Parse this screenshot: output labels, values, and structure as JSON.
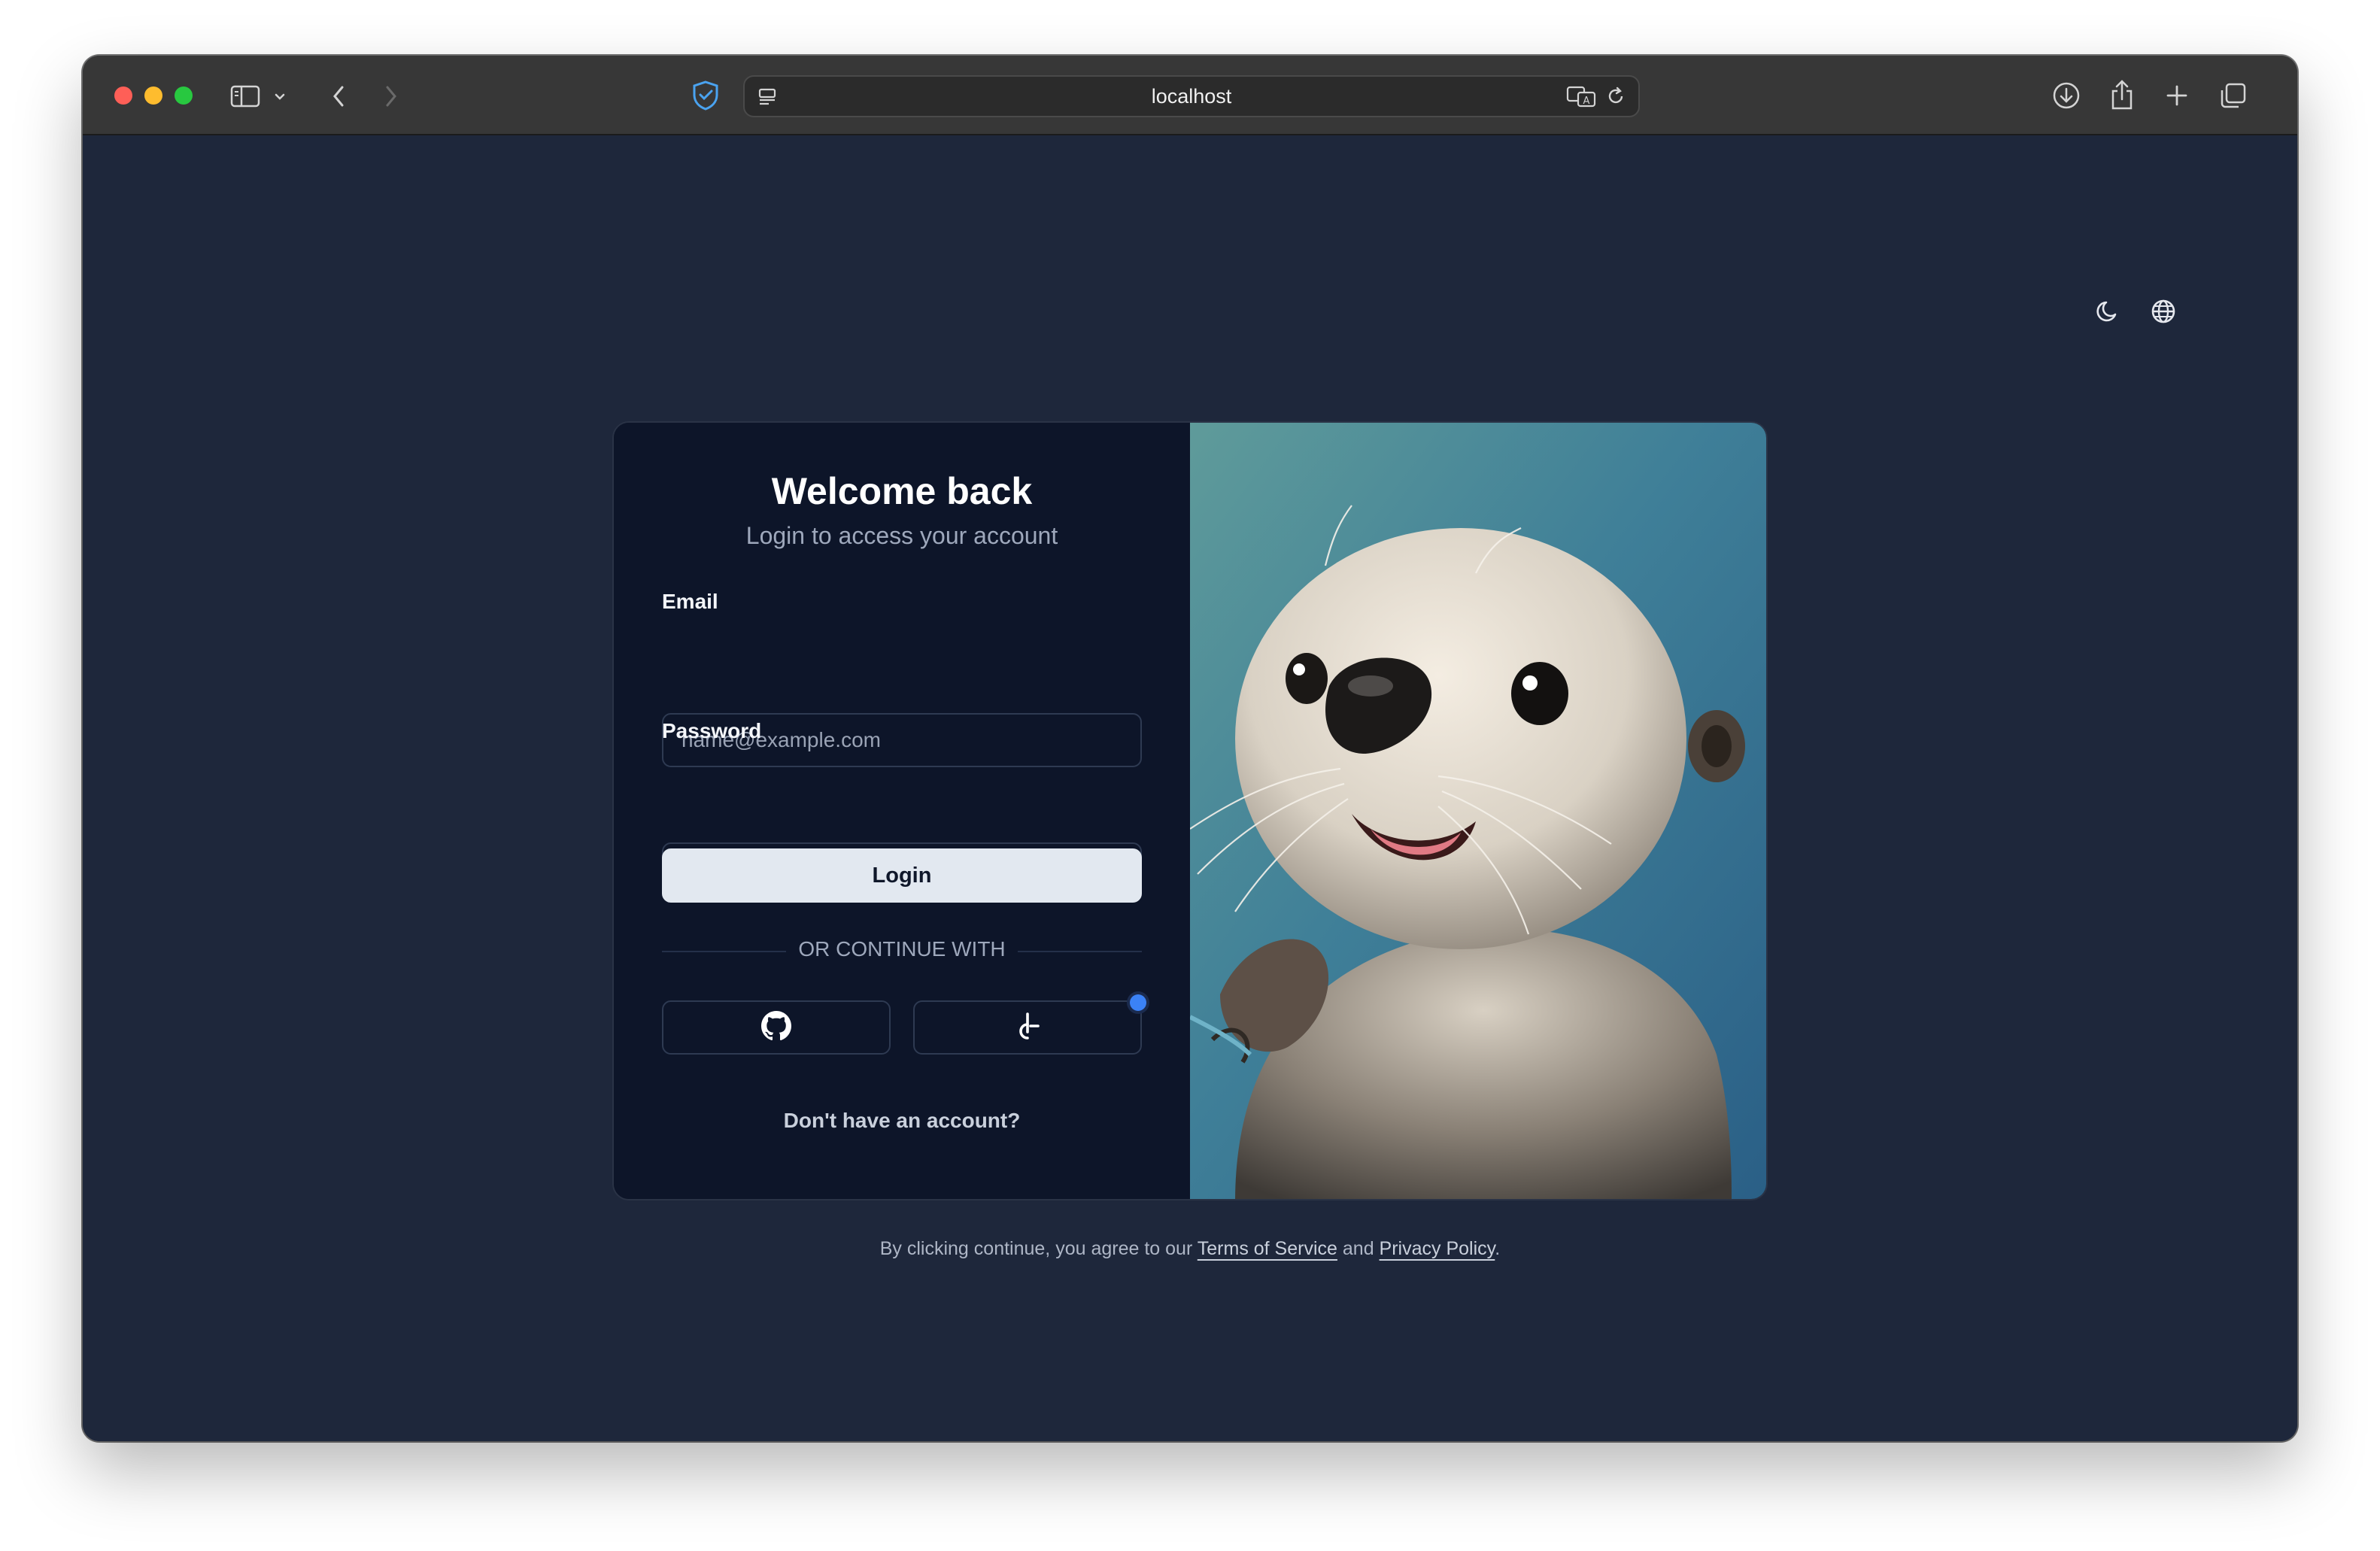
{
  "browser": {
    "url": "localhost"
  },
  "login": {
    "title": "Welcome back",
    "subtitle": "Login to access your account",
    "email_label": "Email",
    "email_placeholder": "name@example.com",
    "password_label": "Password",
    "password_value": "********",
    "login_button": "Login",
    "divider_text": "OR CONTINUE WITH",
    "social_buttons": [
      "github-icon",
      "alternate-provider-icon"
    ],
    "signup_text": "Don't have an account?"
  },
  "footer": {
    "prefix": "By clicking continue, you agree to our ",
    "terms_link": "Terms of Service",
    "middle": " and ",
    "privacy_link": "Privacy Policy",
    "suffix": "."
  },
  "colors": {
    "page_bg": "#1e273b",
    "card_bg": "#0d1529",
    "button_bg": "#e2e8f0",
    "accent_dot": "#3b82f6"
  },
  "illustration": {
    "subject": "sea-otter-illustration"
  }
}
